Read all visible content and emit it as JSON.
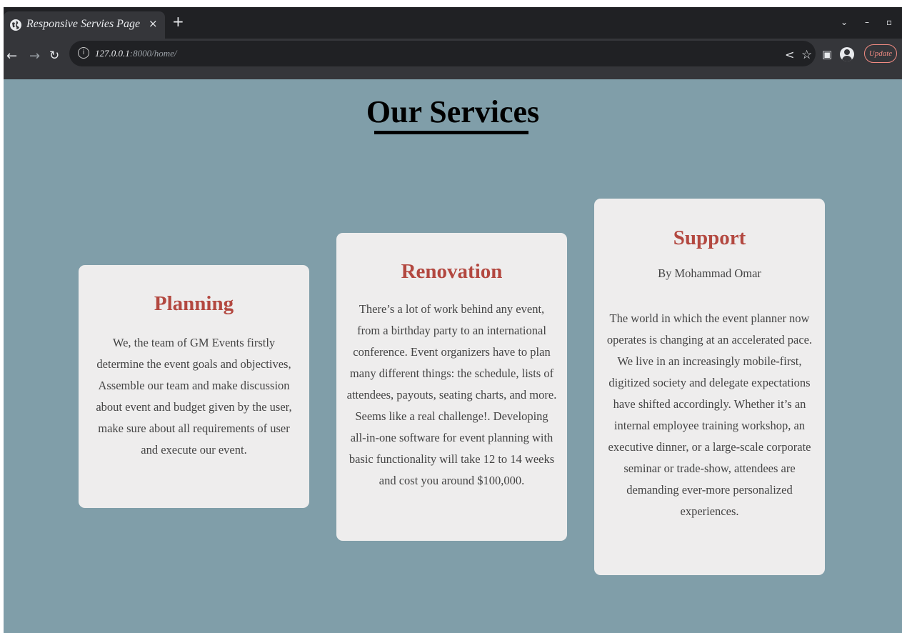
{
  "browser": {
    "tab_title": "Responsive Servies Page",
    "tab_close": "×",
    "new_tab": "+",
    "url_host": "127.0.0.1",
    "url_path": ":8000/home/",
    "update_label": "Update",
    "icons": [
      "globe-icon",
      "back-icon",
      "forward-icon",
      "reload-icon",
      "info-icon",
      "share-icon",
      "star-icon",
      "sidepanel-icon",
      "profile-icon",
      "menu-icon",
      "chevron-down-icon",
      "minimize-icon",
      "maximize-icon"
    ]
  },
  "page": {
    "heading": "Our Services",
    "cards": [
      {
        "title": "Planning",
        "body": [
          "We, the team of GM Events firstly",
          "determine the event goals and objectives,",
          "Assemble our team and make discussion",
          "about event and budget given by the user,",
          "make sure about all requirements of user",
          "and execute our event."
        ]
      },
      {
        "title": "Renovation",
        "body": [
          "There’s a lot of work behind any event,",
          "from a birthday party to an international",
          "conference. Event organizers have to plan",
          "many different things: the schedule, lists of",
          "attendees, payouts, seating charts, and more.",
          "Seems like a real challenge!. Developing",
          "all-in-one software for event planning with",
          "basic functionality will take 12 to 14 weeks",
          "and cost you around $100,000."
        ]
      },
      {
        "title": "Support",
        "byline": "By Mohammad Omar",
        "body": [
          "The world in which the event planner now",
          "operates is changing at an accelerated pace.",
          "We live in an increasingly mobile-first,",
          "digitized society and delegate expectations",
          "have shifted accordingly. Whether it’s an",
          "internal employee training workshop, an",
          "executive dinner, or a large-scale corporate",
          "seminar or trade-show, attendees are",
          "demanding ever-more personalized",
          "experiences."
        ]
      }
    ]
  }
}
